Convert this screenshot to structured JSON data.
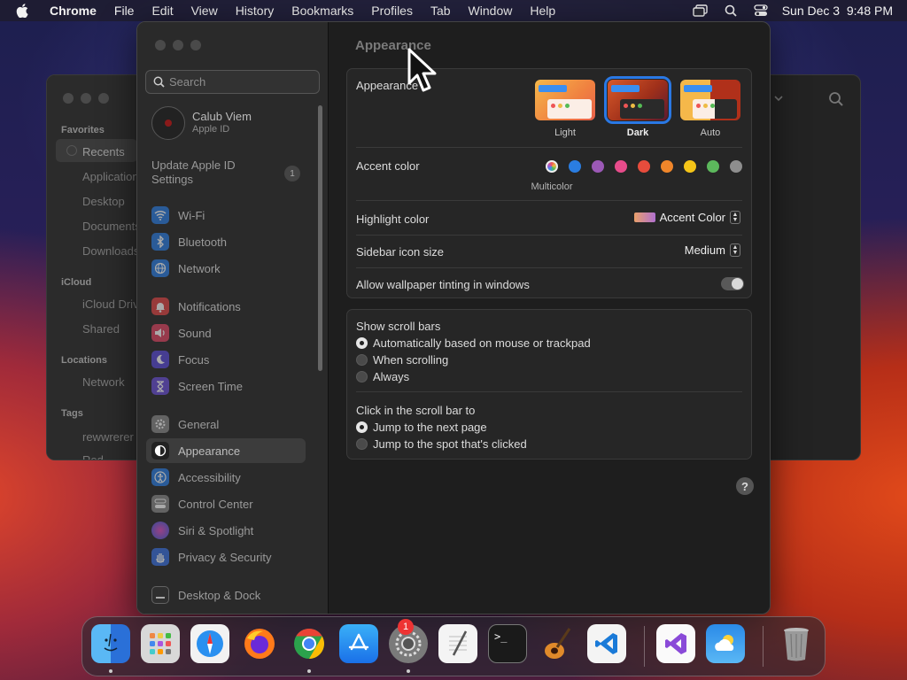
{
  "menubar": {
    "app": "Chrome",
    "items": [
      "File",
      "Edit",
      "View",
      "History",
      "Bookmarks",
      "Profiles",
      "Tab",
      "Window",
      "Help"
    ],
    "datetime": "Sun Dec 3  9:48 PM"
  },
  "finder": {
    "favorites": "Favorites",
    "fav_items": [
      "Recents",
      "Applications",
      "Desktop",
      "Documents",
      "Downloads"
    ],
    "icloud": "iCloud",
    "icloud_items": [
      "iCloud Drive",
      "Shared"
    ],
    "locations": "Locations",
    "location_items": [
      "Network"
    ],
    "tags": "Tags",
    "tag_items": [
      "rewwrerer",
      "Red"
    ]
  },
  "sidebar": {
    "search_placeholder": "Search",
    "user_name": "Calub Viem",
    "user_sub": "Apple ID",
    "update_text": "Update Apple ID Settings",
    "update_badge": "1",
    "items": [
      {
        "label": "Wi-Fi",
        "color": "#2a7de1"
      },
      {
        "label": "Bluetooth",
        "color": "#2a7de1"
      },
      {
        "label": "Network",
        "color": "#2a7de1"
      },
      {
        "label": "Notifications",
        "color": "#e04646"
      },
      {
        "label": "Sound",
        "color": "#e04664"
      },
      {
        "label": "Focus",
        "color": "#5a4ad8"
      },
      {
        "label": "Screen Time",
        "color": "#6a50d8"
      },
      {
        "label": "General",
        "color": "#8a8a8a"
      },
      {
        "label": "Appearance",
        "color": "#222222"
      },
      {
        "label": "Accessibility",
        "color": "#2a7de1"
      },
      {
        "label": "Control Center",
        "color": "#8a8a8a"
      },
      {
        "label": "Siri & Spotlight",
        "color": "#b040c8"
      },
      {
        "label": "Privacy & Security",
        "color": "#3a70e0"
      },
      {
        "label": "Desktop & Dock",
        "color": "#333333"
      }
    ]
  },
  "content": {
    "title": "Appearance",
    "appearance_label": "Appearance",
    "themes": [
      "Light",
      "Dark",
      "Auto"
    ],
    "selected_theme": "Dark",
    "accent_label": "Accent color",
    "accent_colors": [
      "#2a7de1",
      "#9b59b6",
      "#e74c8b",
      "#e74c3c",
      "#f0862a",
      "#f5c518",
      "#5cb85c",
      "#8e8e8e"
    ],
    "multicolor_label": "Multicolor",
    "highlight_label": "Highlight color",
    "highlight_value": "Accent Color",
    "icon_size_label": "Sidebar icon size",
    "icon_size_value": "Medium",
    "tinting_label": "Allow wallpaper tinting in windows",
    "scroll_title": "Show scroll bars",
    "scroll_options": [
      "Automatically based on mouse or trackpad",
      "When scrolling",
      "Always"
    ],
    "click_title": "Click in the scroll bar to",
    "click_options": [
      "Jump to the next page",
      "Jump to the spot that's clicked"
    ],
    "help": "?"
  },
  "dock": {
    "settings_badge": "1",
    "apps": [
      "finder-icon",
      "launchpad-icon",
      "safari-icon",
      "firefox-icon",
      "chrome-icon",
      "app-store-icon",
      "system-settings-icon",
      "textedit-icon",
      "terminal-icon",
      "garageband-icon",
      "vscode-icon",
      "visual-studio-icon",
      "weather-icon",
      "trash-icon"
    ]
  }
}
